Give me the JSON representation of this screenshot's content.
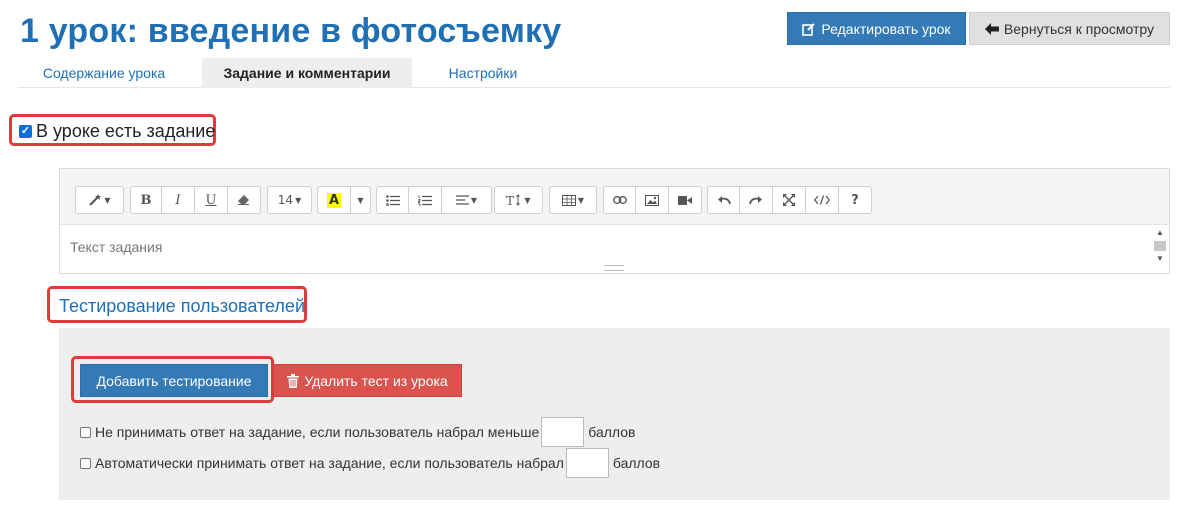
{
  "header": {
    "title": "1 урок: введение в фотосъемку",
    "edit_button": "Редактировать урок",
    "back_button": "Вернуться к просмотру"
  },
  "tabs": [
    {
      "label": "Содержание урока",
      "active": false
    },
    {
      "label": "Задание и комментарии",
      "active": true
    },
    {
      "label": "Настройки",
      "active": false
    }
  ],
  "task": {
    "checkbox_label": "В уроке есть задание",
    "checked": true
  },
  "editor": {
    "font_size": "14",
    "placeholder": "Текст задания",
    "toolbar_icons": [
      "magic-wand-icon",
      "bold-icon",
      "italic-icon",
      "underline-icon",
      "eraser-icon",
      "font-size-dropdown",
      "highlight-color-icon",
      "unordered-list-icon",
      "ordered-list-icon",
      "align-icon",
      "line-height-icon",
      "table-icon",
      "link-icon",
      "image-icon",
      "video-icon",
      "undo-icon",
      "redo-icon",
      "fullscreen-icon",
      "code-view-icon",
      "help-icon"
    ],
    "bold_glyph": "B",
    "italic_glyph": "I",
    "underline_glyph": "U",
    "highlight_glyph": "A",
    "help_glyph": "?"
  },
  "testing": {
    "link_label": "Тестирование пользователей",
    "add_button": "Добавить тестирование",
    "delete_button": "Удалить тест из урока",
    "option_1": {
      "before": "Не принимать ответ на задание, если пользователь набрал меньше",
      "after": "баллов",
      "value": ""
    },
    "option_2": {
      "before": "Автоматически принимать ответ на задание, если пользователь набрал",
      "after": "баллов",
      "value": ""
    }
  },
  "colors": {
    "title": "#1f6fb5",
    "primary": "#337ab7",
    "danger": "#d9534f",
    "highlight_box": "#e03a3a"
  }
}
